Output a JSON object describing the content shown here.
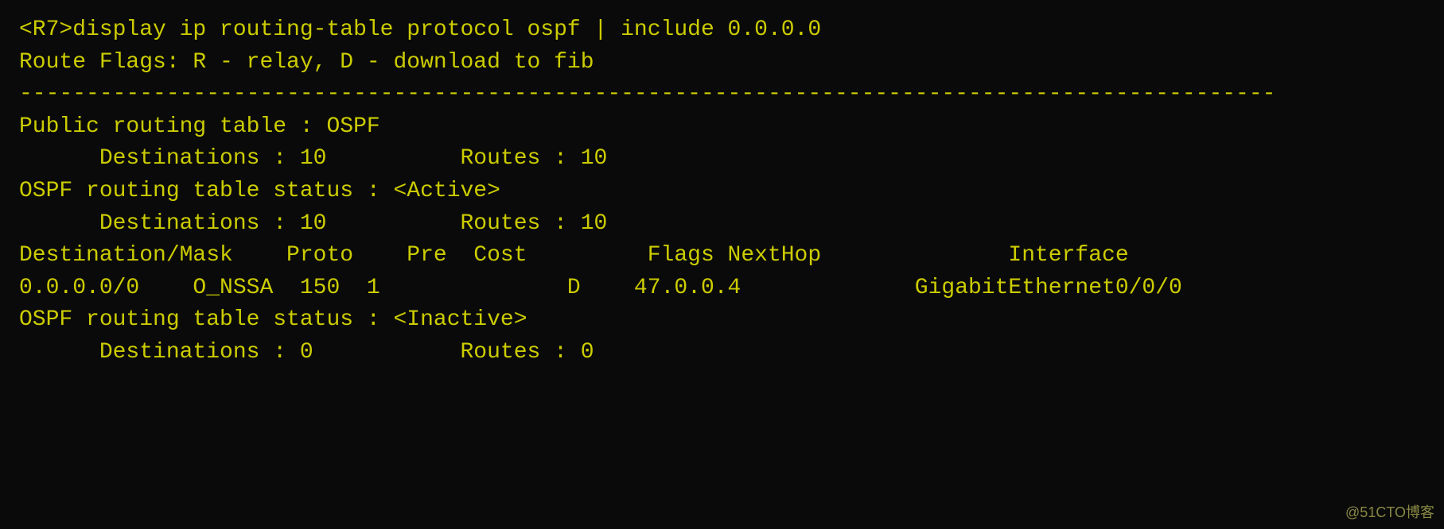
{
  "terminal": {
    "lines": [
      {
        "id": "cmd",
        "text": "<R7>display ip routing-table protocol ospf | include 0.0.0.0"
      },
      {
        "id": "route-flags",
        "text": "Route Flags: R - relay, D - download to fib"
      },
      {
        "id": "separator",
        "text": "----------------------------------------------------------------------------------------------"
      },
      {
        "id": "blank1",
        "text": ""
      },
      {
        "id": "public-table",
        "text": "Public routing table : OSPF"
      },
      {
        "id": "public-dest",
        "text": "      Destinations : 10          Routes : 10"
      },
      {
        "id": "blank2",
        "text": ""
      },
      {
        "id": "ospf-active-header",
        "text": "OSPF routing table status : <Active>"
      },
      {
        "id": "ospf-active-dest",
        "text": "      Destinations : 10          Routes : 10"
      },
      {
        "id": "blank3",
        "text": ""
      },
      {
        "id": "column-header",
        "text": "Destination/Mask    Proto    Pre  Cost         Flags NextHop              Interface"
      },
      {
        "id": "blank4",
        "text": ""
      },
      {
        "id": "route-entry",
        "text": "0.0.0.0/0    O_NSSA  150  1              D    47.0.0.4             GigabitEthernet0/0/0"
      },
      {
        "id": "blank5",
        "text": ""
      },
      {
        "id": "ospf-inactive-header",
        "text": "OSPF routing table status : <Inactive>"
      },
      {
        "id": "ospf-inactive-dest",
        "text": "      Destinations : 0           Routes : 0"
      }
    ],
    "watermark": "@51CTO博客"
  }
}
